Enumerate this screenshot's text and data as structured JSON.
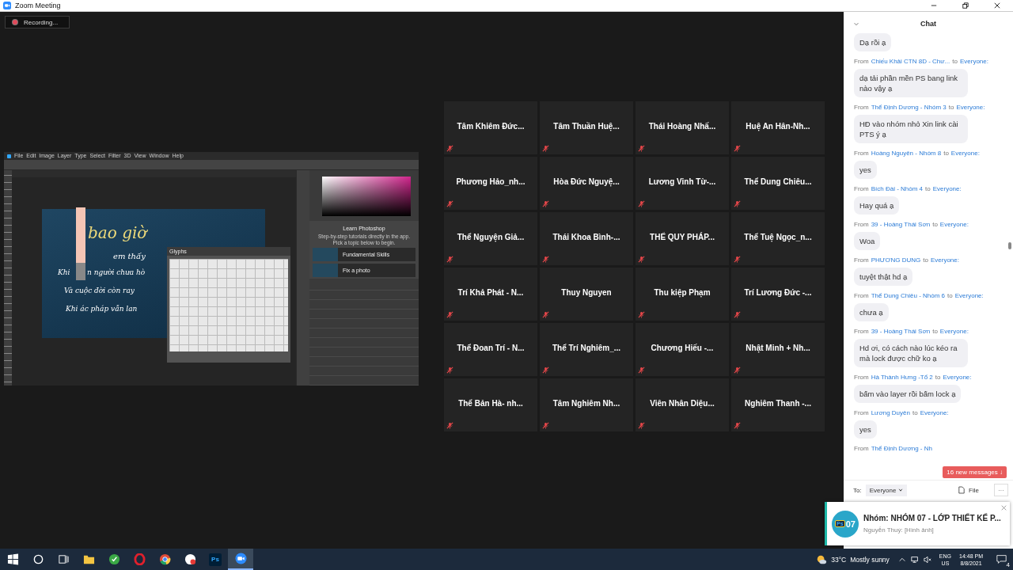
{
  "window": {
    "title": "Zoom Meeting"
  },
  "recording": {
    "label": "Recording..."
  },
  "shared_screen": {
    "menu": [
      "File",
      "Edit",
      "Image",
      "Layer",
      "Type",
      "Select",
      "Filter",
      "3D",
      "View",
      "Window",
      "Help"
    ],
    "canvas_lines": [
      "bao giờ",
      "em thấy",
      "Khi",
      "n người chưa hò",
      "Và cuộc đời còn ray",
      "Khi ác pháp vẫn lan"
    ],
    "glyphs_title": "Glyphs",
    "learn": {
      "title": "Learn Photoshop",
      "text": "Step-by-step tutorials directly in the app. Pick a topic below to begin.",
      "tutorials": [
        "Fundamental Skills",
        "Fix a photo"
      ]
    }
  },
  "gallery": [
    {
      "name": "Tâm Khiêm Đức...",
      "muted": true
    },
    {
      "name": "Tâm Thuần Huệ...",
      "muted": true
    },
    {
      "name": "Thái Hoàng Nhấ...",
      "muted": true
    },
    {
      "name": "Huệ An Hân-Nh...",
      "muted": true
    },
    {
      "name": "Phương Hảo_nh...",
      "muted": true
    },
    {
      "name": "Hòa Đức Nguyệ...",
      "muted": true
    },
    {
      "name": "Lương Vinh Từ-...",
      "muted": true
    },
    {
      "name": "Thể Dung Chiêu...",
      "muted": true
    },
    {
      "name": "Thể Nguyện Giả...",
      "muted": true
    },
    {
      "name": "Thái Khoa Bình-...",
      "muted": true
    },
    {
      "name": "THỂ QUY PHÁP...",
      "muted": true
    },
    {
      "name": "Thể Tuệ Ngọc_n...",
      "muted": true
    },
    {
      "name": "Trí Khả Phát - N...",
      "muted": true
    },
    {
      "name": "Thuy Nguyen",
      "muted": true
    },
    {
      "name": "Thu kiệp Phạm",
      "muted": true
    },
    {
      "name": "Trí Lương Đức -...",
      "muted": true
    },
    {
      "name": "Thể Đoan Trí - N...",
      "muted": true
    },
    {
      "name": "Thể Trí Nghiêm_...",
      "muted": true
    },
    {
      "name": "Chương Hiếu -...",
      "muted": true
    },
    {
      "name": "Nhật Minh + Nh...",
      "muted": true
    },
    {
      "name": "Thể Bản Hà- nh...",
      "muted": true
    },
    {
      "name": "Tâm Nghiêm Nh...",
      "muted": true
    },
    {
      "name": "Viên Nhân Diệu...",
      "muted": true
    },
    {
      "name": "Nghiêm Thanh -...",
      "muted": true
    }
  ],
  "chat": {
    "title": "Chat",
    "messages": [
      {
        "text": "Dạ rồi ạ"
      },
      {
        "from": "From",
        "sender": "Chiếu Khải CTN 8D - Chư...",
        "to": "to",
        "recipient": "Everyone:",
        "text": "dạ tải phần mền PS bang link nào vậy ạ"
      },
      {
        "from": "From",
        "sender": "Thể Định Dương - Nhóm 3",
        "to": "to",
        "recipient": "Everyone:",
        "text": "HĐ vào nhóm nhỏ Xin link cài PTS ý ạ"
      },
      {
        "from": "From",
        "sender": "Hoàng Nguyên - Nhóm 8",
        "to": "to",
        "recipient": "Everyone:",
        "text": "yes"
      },
      {
        "from": "From",
        "sender": "Bích Đài - Nhóm 4",
        "to": "to",
        "recipient": "Everyone:",
        "text": "Hay quá ạ"
      },
      {
        "from": "From",
        "sender": "39 - Hoàng Thái Sơn",
        "to": "to",
        "recipient": "Everyone:",
        "text": "Woa"
      },
      {
        "from": "From",
        "sender": "PHƯƠNG DUNG",
        "to": "to",
        "recipient": "Everyone:",
        "text": "tuyệt thật hd ạ"
      },
      {
        "from": "From",
        "sender": "Thể Dung Chiêu - Nhóm 6",
        "to": "to",
        "recipient": "Everyone:",
        "text": "chưa ạ"
      },
      {
        "from": "From",
        "sender": "39 - Hoàng Thái Sơn",
        "to": "to",
        "recipient": "Everyone:",
        "text": "Hd ơi, có cách nào lúc kéo ra mà lock được chữ ko ạ"
      },
      {
        "from": "From",
        "sender": "Hà Thành Hưng -Tổ 2",
        "to": "to",
        "recipient": "Everyone:",
        "text": "bấm vào layer rồi bấm lock ạ"
      },
      {
        "from": "From",
        "sender": "Lương Duyên",
        "to": "to",
        "recipient": "Everyone:",
        "text": "yes"
      },
      {
        "from": "From",
        "sender": "Thể Định Dương - Nh"
      }
    ],
    "new_messages": "16 new messages ↓",
    "to_label": "To:",
    "recipient": "Everyone",
    "file": "File",
    "more": "···"
  },
  "notification": {
    "badge": "07",
    "app": "Ps",
    "title": "Nhóm: NHÓM 07 - LỚP THIẾT KẾ P...",
    "text": "Nguyễn Thuỷ: [Hình ảnh]"
  },
  "taskbar": {
    "apps": [
      {
        "kind": "start",
        "active": false
      },
      {
        "kind": "search",
        "active": false
      },
      {
        "kind": "taskview",
        "active": false
      },
      {
        "kind": "folder",
        "active": false
      },
      {
        "kind": "green",
        "active": false
      },
      {
        "kind": "opera",
        "active": false
      },
      {
        "kind": "chrome",
        "active": false
      },
      {
        "kind": "redapp",
        "active": false
      },
      {
        "kind": "ps",
        "label": "Ps",
        "active": false
      },
      {
        "kind": "zoom",
        "active": true
      }
    ],
    "weather": "33°C",
    "weather_text": "Mostly sunny",
    "lang": "ENG",
    "region": "US",
    "time": "14:48 PM",
    "date": "8/8/2021",
    "notifications": "4"
  }
}
